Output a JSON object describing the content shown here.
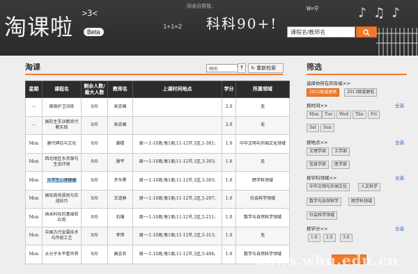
{
  "header": {
    "logo": "淘课啦",
    "logo_doodle": ">3<",
    "beta": "Beta",
    "slogan": "同余且帮我.",
    "math": "1+1=2",
    "chalk_title": "科科90+!",
    "wf": "W=⚲",
    "search_placeholder": "课程名/教师名",
    "search_icon": "search-icon"
  },
  "main": {
    "title": "淘课",
    "sort_value": "时间",
    "sort_up": "↑",
    "refresh_label": "重新检索",
    "columns": [
      "星期",
      "课程名",
      "剩余人数/最大人数",
      "教师名",
      "上课时间地点",
      "学分",
      "所属领域"
    ],
    "rows": [
      {
        "day": "--",
        "name": "国旗护卫训练",
        "seats": "0/0",
        "teacher": "吴忠国",
        "time": "",
        "credit": "2.0",
        "field": "无"
      },
      {
        "day": "--",
        "name": "国防生军训教官代教实践",
        "seats": "0/0",
        "teacher": "吴忠国",
        "time": "",
        "credit": "2.0",
        "field": "无"
      },
      {
        "day": "Mon",
        "name": "唐代碑石与文化",
        "seats": "0/0",
        "teacher": "黄楼",
        "time": "周一:1-10周,每1周;11-12节,1区,1-301;",
        "credit": "1.0",
        "field": "中华文明与外国文化领域"
      },
      {
        "day": "Mon",
        "name": "西北地区水资源与生态环境",
        "seats": "0/0",
        "teacher": "谢平",
        "time": "周一:1-10周,每1周;11-12节,1区,3-303;",
        "credit": "1.0",
        "field": "无"
      },
      {
        "day": "Mon",
        "name": "大学生心理健康",
        "seats": "0/0",
        "teacher": "齐华勇",
        "time": "周一:1-10周,每1周;11-12节,1区,3-303;",
        "credit": "1.0",
        "field": "跨学科领域"
      },
      {
        "day": "Mon",
        "name": "国际商务规则与实战技巧",
        "seats": "0/0",
        "teacher": "王追林",
        "time": "周一:1-10周,每1周;11-12节,1区,5-207;",
        "credit": "1.0",
        "field": "社会科学领域"
      },
      {
        "day": "Mon",
        "name": "纳米科技的基础和应用",
        "seats": "0/0",
        "teacher": "石璞",
        "time": "周一:1-10周,每1周;11-12节,1区,5-211;",
        "credit": "1.0",
        "field": "数学与自然科学领域"
      },
      {
        "day": "Mon",
        "name": "中国古代金属技术与传统工艺",
        "seats": "0/0",
        "teacher": "李萍",
        "time": "周一:1-10周,每1周;11-12节,1区,5-313;",
        "credit": "1.0",
        "field": "无"
      },
      {
        "day": "Mon",
        "name": "从分子水平看世界",
        "seats": "0/0",
        "teacher": "高志农",
        "time": "周一:1-10周,每1周;11-12节,1区,5-404;",
        "credit": "1.0",
        "field": "数学与自然科学领域"
      }
    ]
  },
  "sidebar": {
    "title": "筛选",
    "grade_label": "选择你所在的年级>>",
    "grade_options": [
      "2012级或更高",
      "2013级或更低"
    ],
    "day_label": "按时间>>",
    "all": "全选",
    "days": [
      "Mon",
      "Tue",
      "Wed",
      "Thu",
      "Fri",
      "Sat",
      "Sun"
    ],
    "place_label": "按地点>>",
    "places": [
      "文理学部",
      "工学部",
      "信息学部",
      "医学部"
    ],
    "field_label": "按学科领域>>",
    "fields": [
      "中华文明与外国文化",
      "人文科学",
      "数学与自然科学",
      "跨学科领域",
      "社会科学领域"
    ],
    "credit_label": "按学分>>",
    "credits": [
      "1.0",
      "2.0",
      "3.0"
    ]
  },
  "watermark": "news.whu.edu.cn",
  "colors": {
    "accent": "#f07a2c",
    "header": "#2a2a2a",
    "link": "#2a62c9"
  }
}
